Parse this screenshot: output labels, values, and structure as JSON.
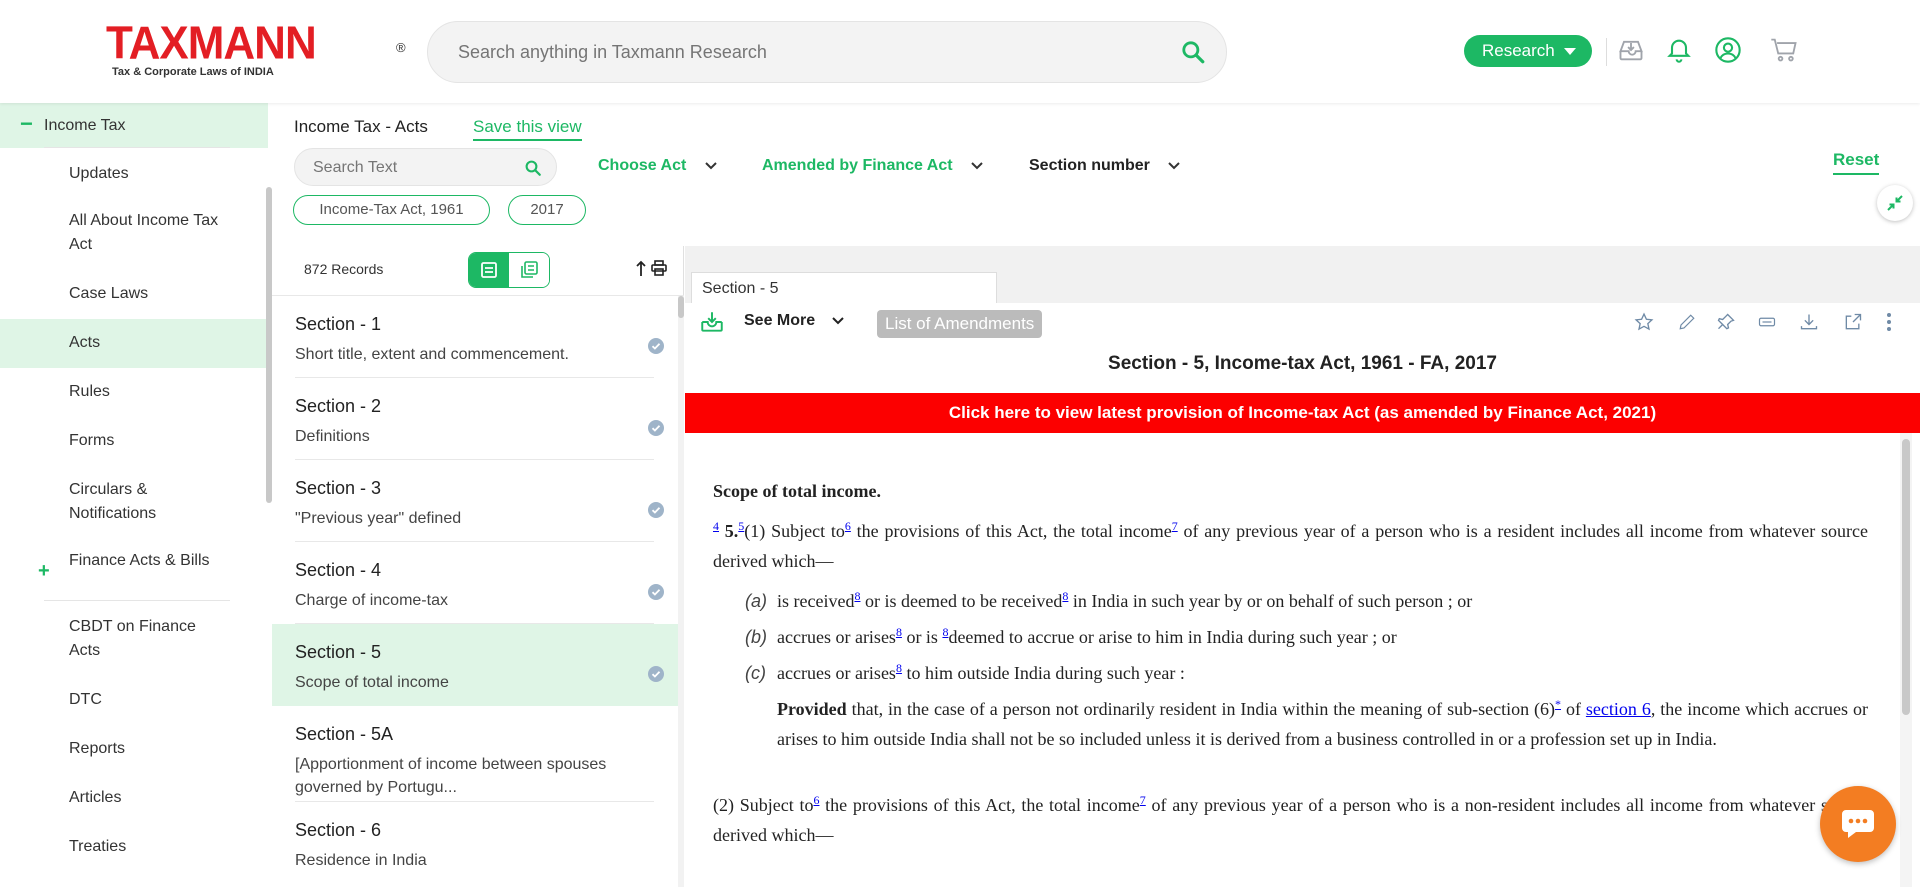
{
  "header": {
    "logo_word": "TAXMANN",
    "logo_reg": "®",
    "logo_tagline": "Tax & Corporate Laws of INDIA",
    "search_placeholder": "Search anything in Taxmann Research",
    "research_label": "Research"
  },
  "sidebar": {
    "top_label": "Income Tax",
    "items": [
      {
        "label": "Updates"
      },
      {
        "label": "All About Income Tax Act"
      },
      {
        "label": "Case Laws"
      },
      {
        "label": "Acts"
      },
      {
        "label": "Rules"
      },
      {
        "label": "Forms"
      },
      {
        "label": "Circulars & Notifications"
      },
      {
        "label": "Finance Acts & Bills"
      },
      {
        "label": "CBDT on Finance Acts"
      },
      {
        "label": "DTC"
      },
      {
        "label": "Reports"
      },
      {
        "label": "Articles"
      },
      {
        "label": "Treaties"
      }
    ]
  },
  "filter": {
    "title": "Income Tax - Acts",
    "save_view": "Save this view",
    "search_placeholder": "Search Text",
    "choose_act": "Choose Act",
    "amended_by": "Amended by Finance Act",
    "section_number": "Section number",
    "reset": "Reset",
    "chips": [
      "Income-Tax Act, 1961",
      "2017"
    ]
  },
  "list": {
    "records": "872 Records",
    "sections": [
      {
        "title": "Section - 1",
        "desc": "Short title, extent and commencement."
      },
      {
        "title": "Section - 2",
        "desc": "Definitions"
      },
      {
        "title": "Section - 3",
        "desc": "\"Previous year\" defined"
      },
      {
        "title": "Section - 4",
        "desc": "Charge of income-tax"
      },
      {
        "title": "Section - 5",
        "desc": "Scope of total income"
      },
      {
        "title": "Section - 5A",
        "desc": "[Apportionment of income between spouses governed by Portugu..."
      },
      {
        "title": "Section - 6",
        "desc": "Residence in India"
      }
    ]
  },
  "doc": {
    "tab_label": "Section - 5",
    "see_more": "See More",
    "list_of_amendments": "List of Amendments",
    "title": "Section - 5, Income-tax Act, 1961 - FA, 2017",
    "red_banner": "Click here to view latest provision of Income-tax Act (as amended by Finance Act, 2021)",
    "heading": "Scope of total income.",
    "p1_fn1": "4",
    "p1_num": "5.",
    "p1_fn2": "5",
    "p1_a": "(1) Subject to",
    "p1_fn3": "6",
    "p1_b": " the provisions of this Act, the total income",
    "p1_fn4": "7",
    "p1_c": " of any previous year of a person who is a resident includes all income from whatever source derived which—",
    "a_letter": "(a)",
    "a_1": "is received",
    "a_fn1": "8",
    "a_2": " or is deemed to be received",
    "a_fn2": "8",
    "a_3": " in India in such year by or on behalf of such person ; or",
    "b_letter": "(b)",
    "b_1": "accrues or arises",
    "b_fn1": "8",
    "b_2": " or is ",
    "b_fn2": "8",
    "b_3": "deemed to accrue or arise to him in India during such year ; or",
    "c_letter": "(c)",
    "c_1": "accrues or arises",
    "c_fn1": "8",
    "c_2": " to him outside India during such year :",
    "proviso_bold": "Provided",
    "proviso_1": " that, in the case of a person not ordinarily resident in India within the meaning of sub-section (6)",
    "proviso_fn": "*",
    "proviso_2": " of ",
    "proviso_link": "section 6",
    "proviso_3": ", the income which accrues or arises to him outside India shall not be so included unless it is derived from a business controlled in or a profession set up in India.",
    "p2_a": "(2) Subject to",
    "p2_fn1": "6",
    "p2_b": " the provisions of this Act, the total income",
    "p2_fn2": "7",
    "p2_c": " of any previous year of a person who is a non-resident includes all income from whatever source derived which—"
  },
  "colors": {
    "brand_red": "#e31e24",
    "accent_green": "#1db864",
    "banner_red": "#fc0000",
    "chat_orange": "#f37d22"
  },
  "icons": [
    "search-icon",
    "inbox-download-icon",
    "bell-icon",
    "user-icon",
    "cart-icon",
    "star-icon",
    "pencil-icon",
    "pin-icon",
    "highlighter-icon",
    "download-icon",
    "external-link-icon",
    "more-vertical-icon",
    "chat-icon"
  ]
}
